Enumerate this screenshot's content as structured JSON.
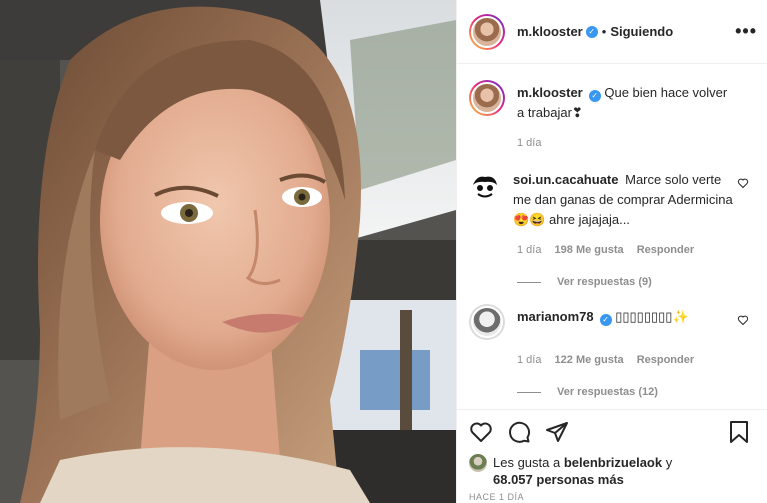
{
  "post": {
    "author": "m.klooster",
    "separator": "•",
    "follow_status": "Siguiendo",
    "more_icon": "•••",
    "verified_glyph": "✓"
  },
  "caption": {
    "author": "m.klooster",
    "text": "Que bien hace volver a trabajar❣",
    "time": "1 día"
  },
  "comments": [
    {
      "author": "soi.un.cacahuate",
      "text": "Marce solo verte me dan ganas de comprar Adermicina😍😆 ahre jajajaja...",
      "time": "1 día",
      "likes": "198 Me gusta",
      "reply": "Responder",
      "view_replies": "Ver respuestas (9)"
    },
    {
      "author": "marianom78",
      "text": "▯▯▯▯▯▯▯▯✨",
      "time": "1 día",
      "likes": "122 Me gusta",
      "reply": "Responder",
      "view_replies": "Ver respuestas (12)"
    }
  ],
  "likes": {
    "prefix": "Les gusta a",
    "user": "belenbrizuelaok",
    "conj": "y",
    "count": "68.057 personas más"
  },
  "timestamp": "HACE 1 DÍA",
  "colors": {
    "verified": "#3897f0",
    "text": "#262626",
    "muted": "#8e8e8e",
    "ring_start": "#f9ce34",
    "ring_end": "#6228d7"
  }
}
